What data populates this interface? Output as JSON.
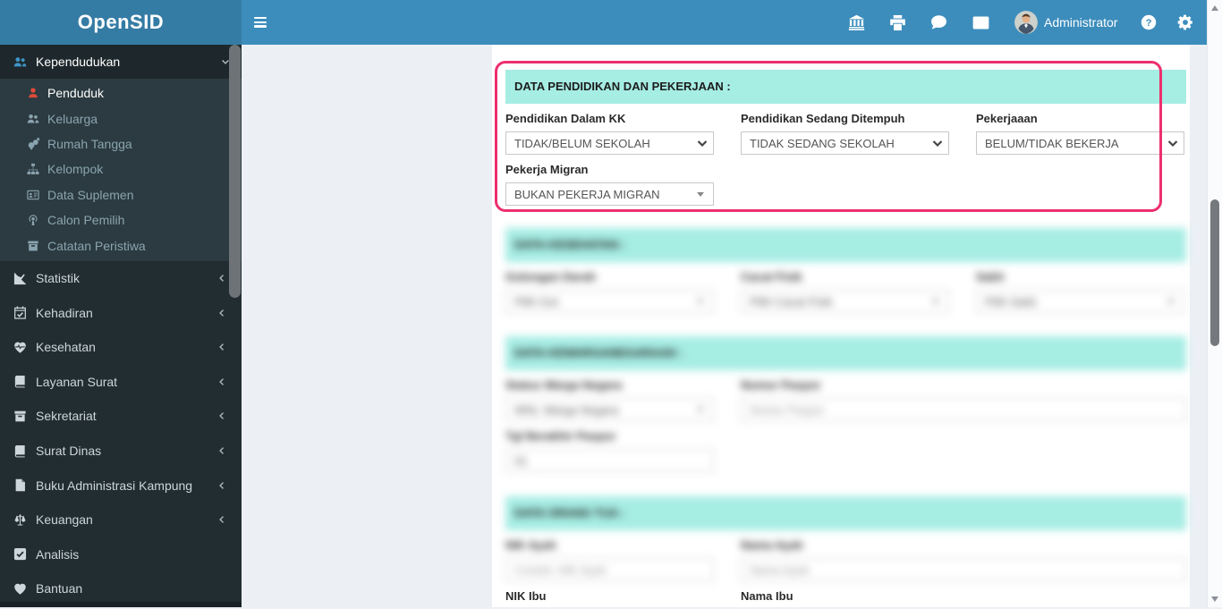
{
  "colors": {
    "navbar": "#3c8dbc",
    "logo_bg": "#357ca5",
    "sidebar_bg": "#222d32",
    "submenu_bg": "#2c3b41",
    "section_header_bg": "#a6ede4",
    "highlight_border": "#ed2f6e",
    "active_icon_red": "#dd4b39",
    "active_icon_blue": "#3f93c6"
  },
  "navbar": {
    "logo": "OpenSID",
    "menu_icon": "hamburger-icon",
    "right_icons": [
      "bank-icon",
      "printer-icon",
      "chat-icon",
      "mail-icon"
    ],
    "user_name": "Administrator",
    "avatar_icon": "avatar-photo",
    "help_icon": "question-circle-icon",
    "settings_icon": "gear-icon"
  },
  "sidebar": {
    "active_group": {
      "label": "Kependudukan",
      "icon": "users-icon"
    },
    "submenu": [
      {
        "label": "Penduduk",
        "icon": "user-icon",
        "active": true
      },
      {
        "label": "Keluarga",
        "icon": "users-icon",
        "active": false
      },
      {
        "label": "Rumah Tangga",
        "icon": "venus-mars-icon",
        "active": false
      },
      {
        "label": "Kelompok",
        "icon": "sitemap-icon",
        "active": false
      },
      {
        "label": "Data Suplemen",
        "icon": "id-card-icon",
        "active": false
      },
      {
        "label": "Calon Pemilih",
        "icon": "podcast-icon",
        "active": false
      },
      {
        "label": "Catatan Peristiwa",
        "icon": "archive-icon",
        "active": false
      }
    ],
    "items": [
      {
        "label": "Statistik",
        "icon": "line-chart-icon",
        "expandable": true
      },
      {
        "label": "Kehadiran",
        "icon": "calendar-check-icon",
        "expandable": true
      },
      {
        "label": "Kesehatan",
        "icon": "heartbeat-icon",
        "expandable": true
      },
      {
        "label": "Layanan Surat",
        "icon": "book-icon",
        "expandable": true
      },
      {
        "label": "Sekretariat",
        "icon": "archive-icon",
        "expandable": true
      },
      {
        "label": "Surat Dinas",
        "icon": "book-icon",
        "expandable": true
      },
      {
        "label": "Buku Administrasi Kampung",
        "icon": "file-text-icon",
        "expandable": true
      },
      {
        "label": "Keuangan",
        "icon": "balance-scale-icon",
        "expandable": true
      },
      {
        "label": "Analisis",
        "icon": "check-square-icon",
        "expandable": false
      },
      {
        "label": "Bantuan",
        "icon": "heart-icon",
        "expandable": false
      }
    ]
  },
  "form": {
    "sections": {
      "pendidikan": {
        "title": "DATA PENDIDIKAN DAN PEKERJAAN :",
        "highlighted": true,
        "fields": {
          "pendidikan_dalam_kk": {
            "label": "Pendidikan Dalam KK",
            "value": "TIDAK/BELUM SEKOLAH"
          },
          "pendidikan_sedang": {
            "label": "Pendidikan Sedang Ditempuh",
            "value": "TIDAK SEDANG SEKOLAH"
          },
          "pekerjaan": {
            "label": "Pekerjaaan",
            "value": "BELUM/TIDAK BEKERJA"
          },
          "pekerja_migran": {
            "label": "Pekerja Migran",
            "value": "BUKAN PEKERJA MIGRAN"
          }
        }
      },
      "kesehatan": {
        "blurred": true,
        "title": "DATA KESEHATAN :",
        "fields": {
          "golongan_darah": {
            "label": "Golongan Darah",
            "value": "Pilih Gol."
          },
          "cacat": {
            "label": "Cacat Fisik",
            "value": "Pilih Cacat Fisik"
          },
          "sakit": {
            "label": "Sakit",
            "value": "Pilih Sakit"
          }
        }
      },
      "kewarganegaraan": {
        "blurred": true,
        "title": "DATA KEWARGANEGARAAN :",
        "fields": {
          "warga_negara": {
            "label": "Status Warga Negara",
            "value": "WNI, Warga Negara"
          },
          "nomor_paspor": {
            "label": "Nomor Paspor",
            "placeholder": "Nomor Paspor"
          },
          "tgl_paspor": {
            "label": "Tgl Berakhir Paspor",
            "value": "01"
          }
        }
      },
      "orang_tua": {
        "title": "DATA ORANG TUA :",
        "title_blurred": true,
        "blurred_fields": {
          "nik_ayah": {
            "label": "NIK Ayah",
            "placeholder": "Contoh: NIK Ayah"
          },
          "nama_ayah": {
            "label": "Nama Ayah",
            "placeholder": "Nama Ayah"
          }
        },
        "visible_fields": {
          "nik_ibu": {
            "label": "NIK Ibu"
          },
          "nama_ibu": {
            "label": "Nama Ibu"
          }
        }
      }
    }
  }
}
